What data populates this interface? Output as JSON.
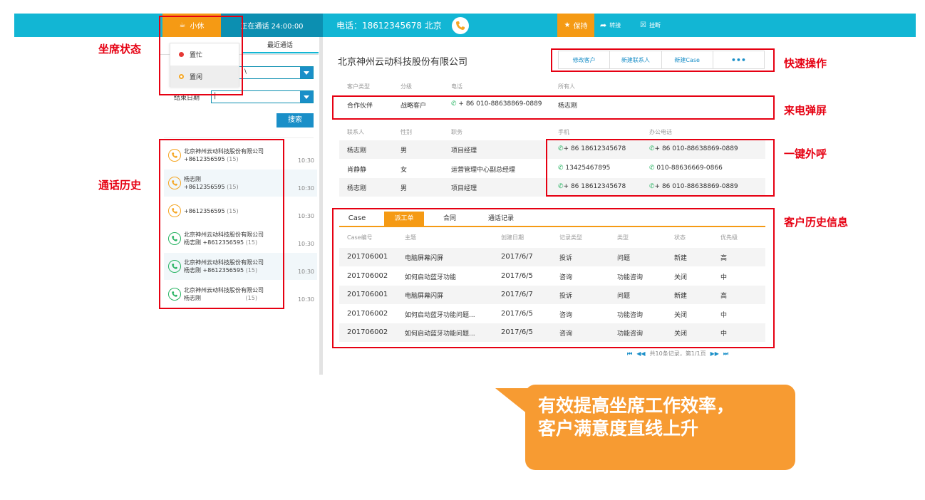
{
  "topbar": {
    "status_label": "小休",
    "call_status": "正在通话 24:00:00",
    "phone_label": "电话：18612345678  北京",
    "hold_label": "保持",
    "transfer_label": "转接",
    "hangup_label": "挂断"
  },
  "left": {
    "recent_tab": "最近通话",
    "status_options": [
      {
        "label": "置忙",
        "color": "#e53935"
      },
      {
        "label": "置闲",
        "color": "#f5a623"
      }
    ],
    "start_date_label": "",
    "start_date_value": "\\",
    "end_date_label": "结束日期",
    "end_date_value": "|",
    "search_label": "搜索",
    "history": [
      {
        "line1": "北京神州云动科技股份有限公司",
        "line2": "+8612356595",
        "count": "(15)",
        "time": "10:30",
        "icon": "orange"
      },
      {
        "line1": "杨志刚",
        "line2": "+8612356595",
        "count": "(15)",
        "time": "10:30",
        "icon": "orange"
      },
      {
        "line1": "",
        "line2": "+8612356595",
        "count": "(15)",
        "time": "10:30",
        "icon": "orange"
      },
      {
        "line1": "北京神州云动科技股份有限公司",
        "line2": "杨志刚     +8612356595",
        "count": "(15)",
        "time": "10:30",
        "icon": "green"
      },
      {
        "line1": "北京神州云动科技股份有限公司",
        "line2": "杨志刚     +8612356595",
        "count": "(15)",
        "time": "10:30",
        "icon": "green"
      },
      {
        "line1": "北京神州云动科技股份有限公司",
        "line2": "杨志刚",
        "count": "(15)",
        "time": "10:30",
        "icon": "green"
      }
    ]
  },
  "right": {
    "company": "北京神州云动科技股份有限公司",
    "actions": [
      "修改客户",
      "新建联系人",
      "新建Case",
      "•••"
    ],
    "info_headers": [
      "客户类型",
      "分级",
      "电话",
      "所有人"
    ],
    "info_values": [
      "合作伙伴",
      "战略客户",
      "+ 86 010-88638869-0889",
      "杨志刚"
    ],
    "contact_headers": [
      "联系人",
      "性别",
      "职务",
      "手机",
      "办公电话"
    ],
    "contacts": [
      {
        "name": "杨志刚",
        "gender": "男",
        "title": "项目经理",
        "mobile": "+ 86 18612345678",
        "office": "+ 86 010-88638869-0889"
      },
      {
        "name": "肖静静",
        "gender": "女",
        "title": "运营管理中心副总经理",
        "mobile": "13425467895",
        "office": "010-88636669-0866"
      },
      {
        "name": "杨志刚",
        "gender": "男",
        "title": "项目经理",
        "mobile": "+ 86 18612345678",
        "office": "+ 86 010-88638869-0889"
      }
    ],
    "tabs": [
      "Case",
      "派工单",
      "合同",
      "通话记录"
    ],
    "case_headers": [
      "Case编号",
      "主题",
      "创建日期",
      "记录类型",
      "类型",
      "状态",
      "优先级"
    ],
    "cases": [
      [
        "201706001",
        "电脑屏幕闪屏",
        "2017/6/7",
        "投诉",
        "问题",
        "新建",
        "高"
      ],
      [
        "201706002",
        "如何启动蓝牙功能",
        "2017/6/5",
        "咨询",
        "功能咨询",
        "关闭",
        "中"
      ],
      [
        "201706001",
        "电脑屏幕闪屏",
        "2017/6/7",
        "投诉",
        "问题",
        "新建",
        "高"
      ],
      [
        "201706002",
        "如何启动蓝牙功能问题...",
        "2017/6/5",
        "咨询",
        "功能咨询",
        "关闭",
        "中"
      ],
      [
        "201706002",
        "如何启动蓝牙功能问题...",
        "2017/6/5",
        "咨询",
        "功能咨询",
        "关闭",
        "中"
      ]
    ],
    "pager_text": "共10条记录，第1/1页"
  },
  "annotations": {
    "agent_status": "坐席状态",
    "call_history": "通话历史",
    "quick_actions": "快速操作",
    "screen_pop": "来电弹屏",
    "one_click_dial": "一键外呼",
    "customer_history": "客户历史信息"
  },
  "callout": {
    "line1": "有效提高坐席工作效率，",
    "line2": "客户满意度直线上升"
  },
  "colors": {
    "topbar": "#12b6d4",
    "accent_orange": "#f59a14",
    "link_blue": "#1a8fc8",
    "annotation_red": "#e60012",
    "phone_green": "#28b463"
  }
}
